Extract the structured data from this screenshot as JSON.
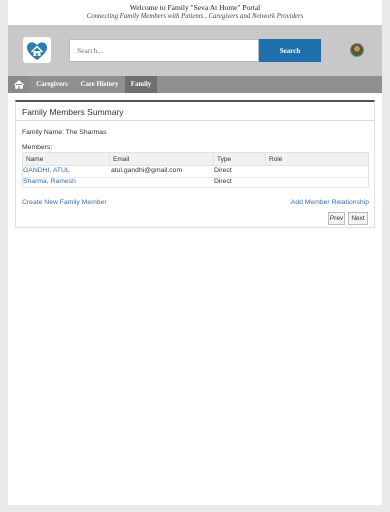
{
  "header": {
    "title": "Welcome to Family \"Seva At Home\" Portal",
    "subtitle": "Connecting Family Members with Patients , Caregivers and Network Providers"
  },
  "search": {
    "placeholder": "Search...",
    "button_label": "Search"
  },
  "nav": {
    "items": [
      {
        "label": "Caregivers"
      },
      {
        "label": "Care History"
      },
      {
        "label": "Family"
      }
    ],
    "active": "Family"
  },
  "panel": {
    "title": "Family Members Summary",
    "family_name": "Family Name: The Sharmas",
    "members_label": "Members:",
    "columns": [
      "Name",
      "Email",
      "Type",
      "Role"
    ],
    "rows": [
      {
        "name": "GANDHI, ATUL",
        "email": "atul.gandhi@gmail.com",
        "type": "Direct",
        "role": ""
      },
      {
        "name": "Sharma, Ramesh",
        "email": "",
        "type": "Direct",
        "role": ""
      }
    ],
    "create_link": "Create New Family Member",
    "add_link": "Add Member Relationship",
    "prev_label": "Prev",
    "next_label": "Next"
  },
  "colors": {
    "search_button": "#1f6fad",
    "nav_bar": "#8f8f8f",
    "link": "#3a6fb0"
  }
}
